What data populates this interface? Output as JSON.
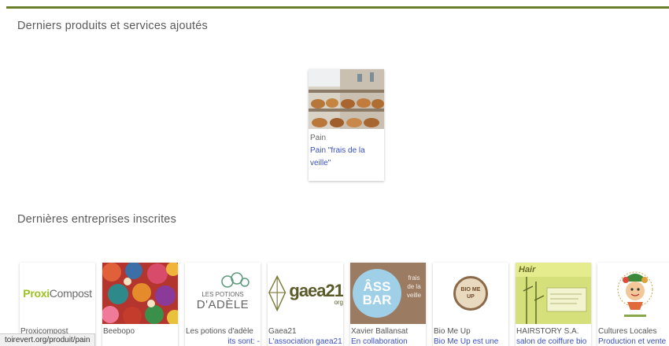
{
  "sections": {
    "products_title": "Derniers produits et services ajoutés",
    "companies_title": "Dernières entreprises inscrites"
  },
  "product": {
    "category": "Pain",
    "title_line1": "Pain \"frais de la",
    "title_line2": "veille\""
  },
  "companies": [
    {
      "name": "Proxicompost",
      "desc": ""
    },
    {
      "name": "Beebopo",
      "desc": ""
    },
    {
      "name": "Les potions d'adèle",
      "desc": "its sont: -"
    },
    {
      "name": "Gaea21",
      "desc": "L'association gaea21"
    },
    {
      "name": "Xavier Ballansat",
      "desc": "En collaboration"
    },
    {
      "name": "Bio Me Up",
      "desc": "Bio Me Up est une"
    },
    {
      "name": "HAIRSTORY S.A.",
      "desc": "salon de coiffure bio"
    },
    {
      "name": "Cultures Locales",
      "desc": "Production et vente"
    }
  ],
  "logos": {
    "proxi_a": "Proxi",
    "proxi_b": "Compost",
    "potions_a": "LES POTIONS",
    "potions_b": "D'ADÈLE",
    "gaea_a": "gaea21",
    "gaea_b": "org",
    "xb_a": "ÂSS",
    "xb_b": "BAR",
    "xb_c": "frais de la veille",
    "biome": "BIO ME UP",
    "hair": "Hair"
  },
  "status_url": "toirevert.org/produit/pain",
  "colors": {
    "accent_bar": "#6b7f2a",
    "link": "#3a4fc0",
    "proxi_green": "#9bc21e"
  }
}
